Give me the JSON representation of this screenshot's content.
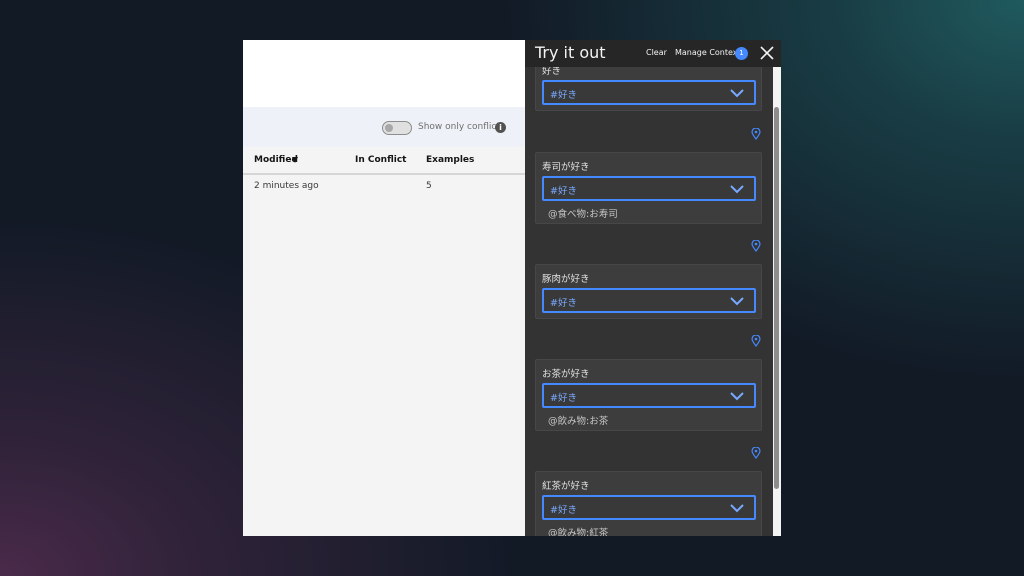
{
  "left_panel": {
    "toggle_label": "Show only conflicts",
    "columns": [
      "Modified",
      "In Conflict",
      "Examples"
    ],
    "rows": [
      {
        "modified": "2 minutes ago",
        "in_conflict": "",
        "examples": "5"
      }
    ]
  },
  "try_panel": {
    "title": "Try it out",
    "clear_label": "Clear",
    "manage_context_label": "Manage Context",
    "context_count": "1",
    "cards": [
      {
        "utterance": "好き",
        "intent": "#好き",
        "entity": ""
      },
      {
        "utterance": "寿司が好き",
        "intent": "#好き",
        "entity": "@食べ物:お寿司"
      },
      {
        "utterance": "豚肉が好き",
        "intent": "#好き",
        "entity": ""
      },
      {
        "utterance": "お茶が好き",
        "intent": "#好き",
        "entity": "@飲み物:お茶"
      },
      {
        "utterance": "紅茶が好き",
        "intent": "#好き",
        "entity": "@飲み物:紅茶"
      }
    ]
  },
  "colors": {
    "accent": "#4589ff",
    "panel_bg": "#333333",
    "header_bg": "#262626"
  }
}
